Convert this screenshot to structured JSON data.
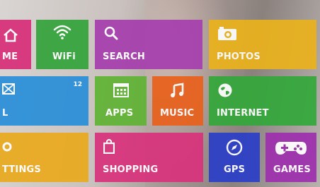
{
  "tiles": {
    "home": {
      "label": "ME",
      "color": "#d92f7a",
      "icon": "home-icon"
    },
    "wifi": {
      "label": "WiFi",
      "color": "#35a43c",
      "icon": "wifi-icon"
    },
    "search": {
      "label": "SEARCH",
      "color": "#a63fae",
      "icon": "search-icon"
    },
    "photos": {
      "label": "PHOTOS",
      "color": "#eab21c",
      "icon": "camera-icon"
    },
    "mail": {
      "label": "L",
      "color": "#2a8fd8",
      "icon": "mail-icon",
      "badge": "12"
    },
    "apps": {
      "label": "APPS",
      "color": "#60b335",
      "icon": "apps-icon"
    },
    "music": {
      "label": "MUSIC",
      "color": "#e8611c",
      "icon": "music-icon"
    },
    "internet": {
      "label": "INTERNET",
      "color": "#34a83b",
      "icon": "globe-icon"
    },
    "settings": {
      "label": "TTINGS",
      "color": "#eaaa1f",
      "icon": "gear-icon"
    },
    "shopping": {
      "label": "SHOPPING",
      "color": "#d8337c",
      "icon": "shopping-bag-icon"
    },
    "gps": {
      "label": "GPS",
      "color": "#2c3fc8",
      "icon": "compass-icon"
    },
    "games": {
      "label": "GAMES",
      "color": "#9e2fae",
      "icon": "gamepad-icon"
    }
  }
}
